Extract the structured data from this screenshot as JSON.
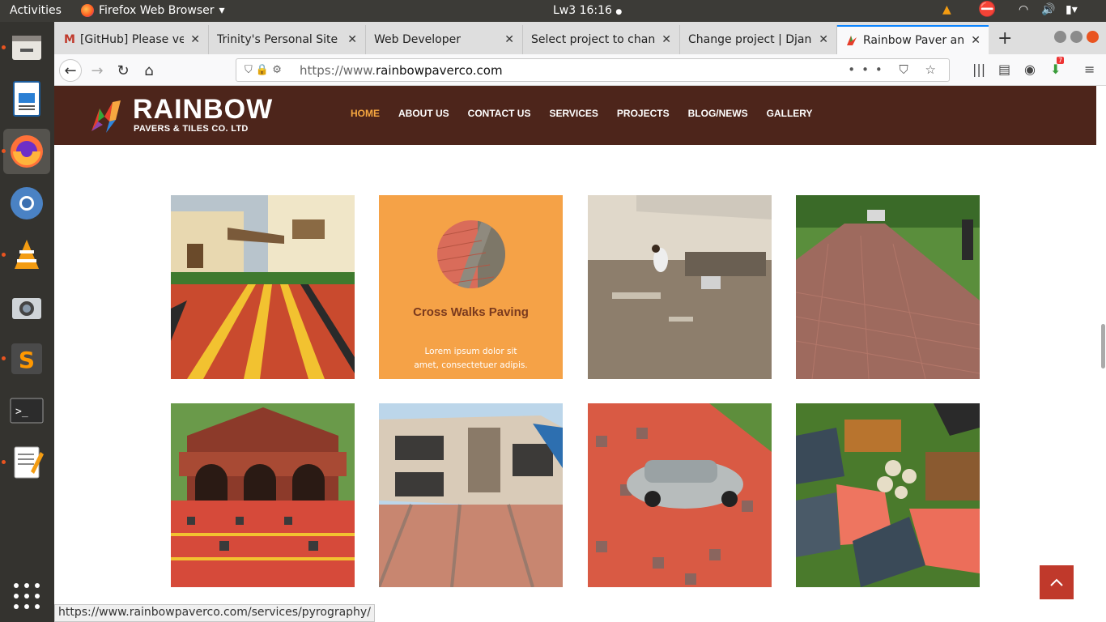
{
  "topbar": {
    "activities": "Activities",
    "app_name": "Firefox Web Browser",
    "clock": "Lw3 16:16"
  },
  "tabs": [
    {
      "title": "[GitHub] Please verif",
      "close": "✕"
    },
    {
      "title": "Trinity's Personal Site",
      "close": "✕"
    },
    {
      "title": "Web Developer",
      "close": "✕"
    },
    {
      "title": "Select project to chang",
      "close": "✕"
    },
    {
      "title": "Change project | Djang",
      "close": "✕"
    },
    {
      "title": "Rainbow Paver and T",
      "close": "✕"
    }
  ],
  "browser": {
    "url_prefix": "https://www.",
    "url_domain": "rainbowpaverco.com",
    "download_badge": "7"
  },
  "site": {
    "logo_main": "RAINBOW",
    "logo_sub": "PAVERS & TILES CO. LTD",
    "menu": [
      "HOME",
      "ABOUT US",
      "CONTACT US",
      "SERVICES",
      "PROJECTS",
      "BLOG/NEWS",
      "GALLERY"
    ],
    "active_menu": "HOME",
    "colors": {
      "header": "#4d251b",
      "accent": "#f7a740",
      "feature_bg": "#f5a247"
    }
  },
  "feature": {
    "title": "Cross Walks Paving",
    "description": "Lorem ipsum dolor sit amet, consectetuer adipis."
  },
  "status_url": "https://www.rainbowpaverco.com/services/pyrography/"
}
